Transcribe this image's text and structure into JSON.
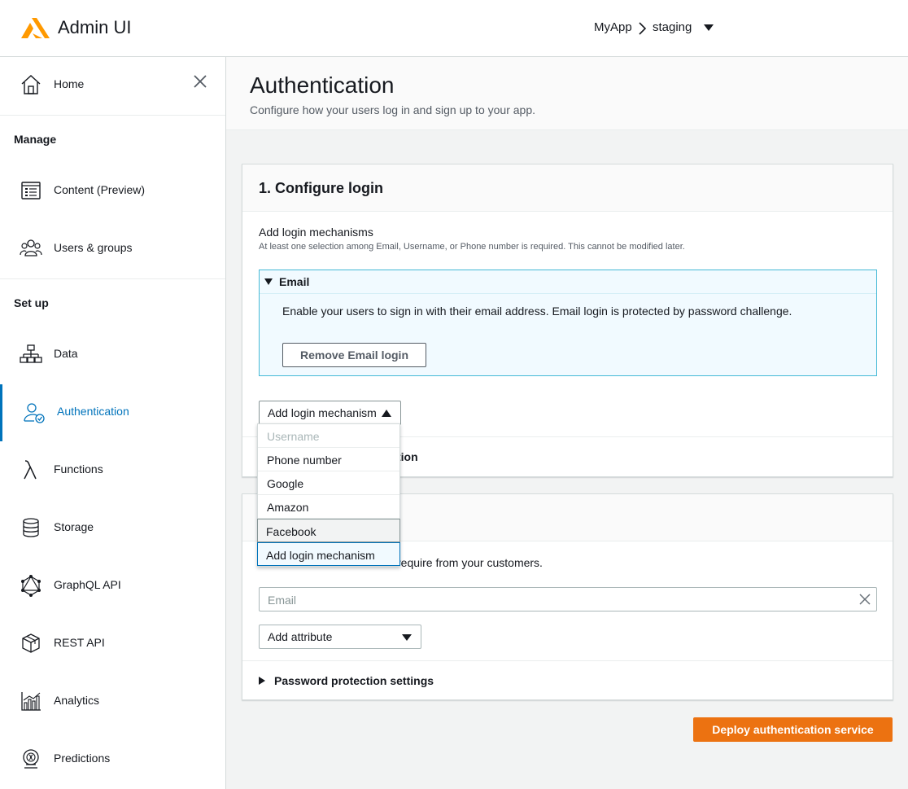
{
  "header": {
    "app_title": "Admin UI",
    "breadcrumb": {
      "app": "MyApp",
      "environment": "staging"
    },
    "colors": {
      "logo": "#ff9900"
    }
  },
  "sidebar": {
    "home": "Home",
    "sections": [
      {
        "title": "Manage",
        "items": [
          {
            "label": "Content (Preview)",
            "icon": "content-icon"
          },
          {
            "label": "Users & groups",
            "icon": "users-icon"
          }
        ]
      },
      {
        "title": "Set up",
        "items": [
          {
            "label": "Data",
            "icon": "data-model-icon"
          },
          {
            "label": "Authentication",
            "icon": "user-check-icon",
            "active": true
          },
          {
            "label": "Functions",
            "icon": "lambda-icon"
          },
          {
            "label": "Storage",
            "icon": "database-icon"
          },
          {
            "label": "GraphQL API",
            "icon": "graphql-icon"
          },
          {
            "label": "REST API",
            "icon": "cube-icon"
          },
          {
            "label": "Analytics",
            "icon": "bar-chart-icon"
          },
          {
            "label": "Predictions",
            "icon": "brain-icon"
          }
        ]
      }
    ]
  },
  "page": {
    "title": "Authentication",
    "subtitle": "Configure how your users log in and sign up to your app."
  },
  "login_card": {
    "title": "1. Configure login",
    "mechanisms_title": "Add login mechanisms",
    "mechanisms_note": "At least one selection among Email, Username, or Phone number is required. This cannot be modified later.",
    "email": {
      "label": "Email",
      "description": "Enable your users to sign in with their email address. Email login is protected by password challenge.",
      "remove_button": "Remove Email login"
    },
    "add_mechanism": "Add login mechanism",
    "partially_hidden_row": "tion"
  },
  "dropdown": {
    "options": [
      {
        "label": "Username",
        "state": "disabled"
      },
      {
        "label": "Phone number",
        "state": "normal"
      },
      {
        "label": "Google",
        "state": "normal"
      },
      {
        "label": "Amazon",
        "state": "normal"
      },
      {
        "label": "Facebook",
        "state": "hover"
      },
      {
        "label": "Add login mechanism",
        "state": "selected"
      }
    ]
  },
  "signup_card": {
    "description_visible": "require from your customers.",
    "attribute_value": "Email",
    "add_attribute": "Add attribute",
    "password_settings": "Password protection settings"
  },
  "deploy_button": "Deploy authentication service",
  "colors": {
    "accent": "#0073bb",
    "primary_button": "#ec7211",
    "email_box_border": "#44b9d6"
  }
}
